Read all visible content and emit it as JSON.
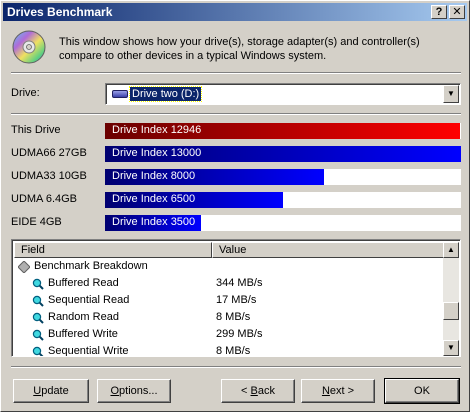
{
  "window": {
    "title": "Drives Benchmark",
    "help_label": "?",
    "close_label": "✕"
  },
  "intro": {
    "icon": "cd-disc-icon",
    "text": "This window shows how your drive(s), storage adapter(s) and controller(s) compare to other devices in a typical Windows system."
  },
  "drive": {
    "label": "Drive:",
    "selected": "Drive two (D:)",
    "icon": "drive-icon"
  },
  "benchmarks": [
    {
      "label": "This Drive",
      "bar_text": "Drive Index 12946",
      "value": 12946,
      "style": "red"
    },
    {
      "label": "UDMA66 27GB",
      "bar_text": "Drive Index 13000",
      "value": 13000,
      "style": "blue"
    },
    {
      "label": "UDMA33 10GB",
      "bar_text": "Drive Index 8000",
      "value": 8000,
      "style": "blue"
    },
    {
      "label": "UDMA 6.4GB",
      "bar_text": "Drive Index 6500",
      "value": 6500,
      "style": "blue"
    },
    {
      "label": "EIDE 4GB",
      "bar_text": "Drive Index 3500",
      "value": 3500,
      "style": "blue"
    }
  ],
  "colors": {
    "this_drive_start": "#6a0000",
    "this_drive_end": "#ff0000",
    "compare_start": "#000070",
    "compare_end": "#0000ff"
  },
  "list": {
    "columns": {
      "field": "Field",
      "value": "Value"
    },
    "rows": [
      {
        "field": "Benchmark Breakdown",
        "value": "",
        "icon": "diamond-icon",
        "kind": "group"
      },
      {
        "field": "Buffered Read",
        "value": "344 MB/s",
        "icon": "magnifier-icon",
        "kind": "item"
      },
      {
        "field": "Sequential Read",
        "value": "17 MB/s",
        "icon": "magnifier-icon",
        "kind": "item"
      },
      {
        "field": "Random Read",
        "value": "8 MB/s",
        "icon": "magnifier-icon",
        "kind": "item"
      },
      {
        "field": "Buffered Write",
        "value": "299 MB/s",
        "icon": "magnifier-icon",
        "kind": "item"
      },
      {
        "field": "Sequential Write",
        "value": "8 MB/s",
        "icon": "magnifier-icon",
        "kind": "item"
      }
    ],
    "scroll_position": 0.68
  },
  "buttons": {
    "update": {
      "mnemonic": "U",
      "rest": "pdate"
    },
    "options": {
      "mnemonic": "O",
      "rest": "ptions..."
    },
    "back": {
      "prefix": "< ",
      "mnemonic": "B",
      "rest": "ack"
    },
    "next": {
      "mnemonic": "N",
      "rest": "ext >"
    },
    "ok": "OK"
  }
}
